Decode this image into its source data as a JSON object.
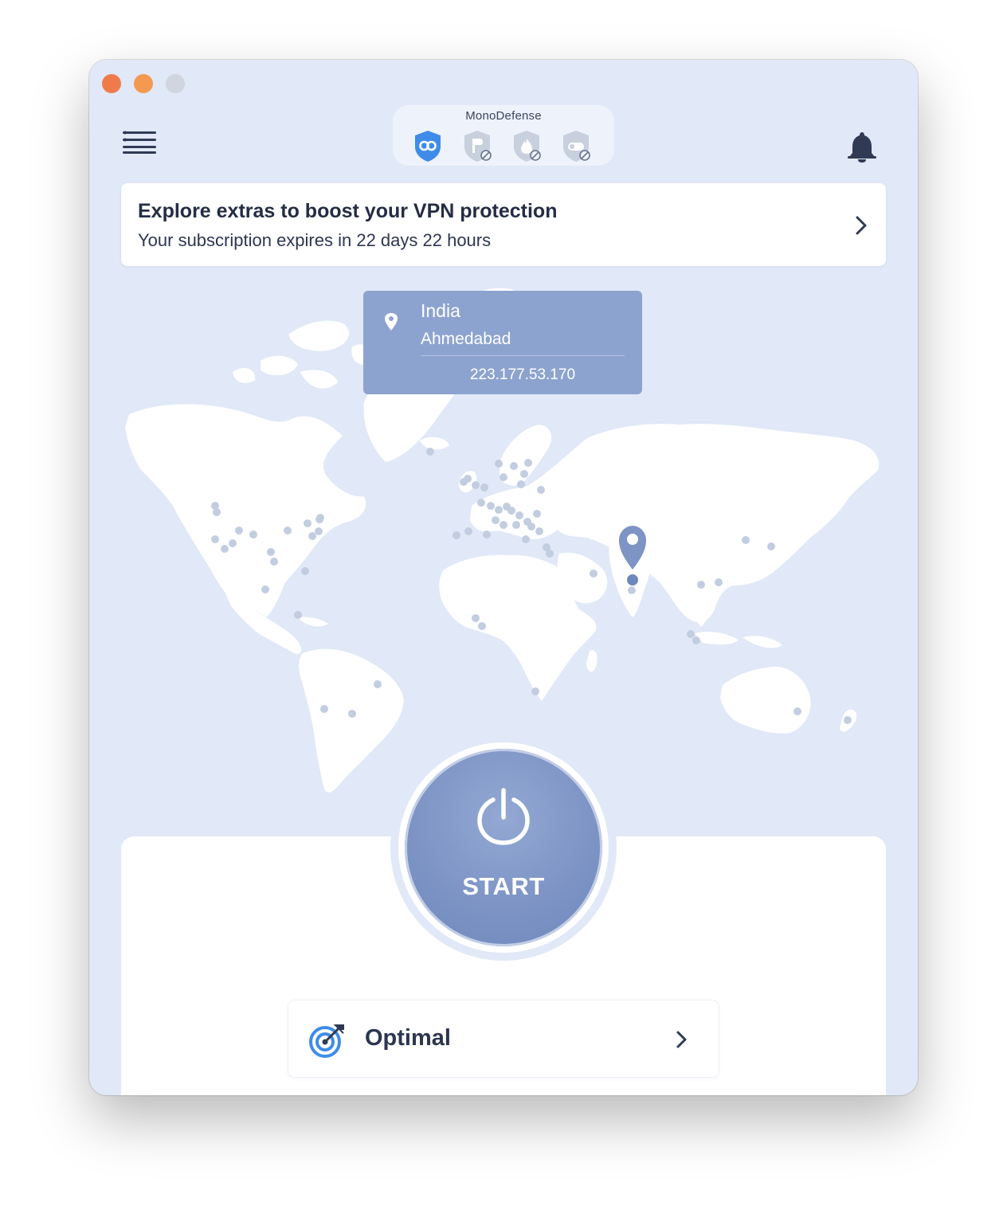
{
  "window": {
    "title": "MonoDefense"
  },
  "header": {
    "menu_icon": "hamburger-menu-icon",
    "bell_icon": "bell-icon",
    "monodefense": {
      "title": "MonoDefense",
      "products": [
        {
          "name": "vpn-shield-icon",
          "active": true,
          "color": "#3f8ce8"
        },
        {
          "name": "passwarden-shield-icon",
          "active": false
        },
        {
          "name": "dataspy-shield-icon",
          "active": false
        },
        {
          "name": "toggle-shield-icon",
          "active": false
        }
      ]
    }
  },
  "banner": {
    "title": "Explore extras to boost your VPN protection",
    "subtitle": "Your subscription expires in 22 days 22 hours"
  },
  "location": {
    "country": "India",
    "city": "Ahmedabad",
    "ip": "223.177.53.170"
  },
  "power": {
    "label": "START",
    "color": "#7d94c5"
  },
  "protocol": {
    "label": "Optimal",
    "icon": "target-icon"
  },
  "colors": {
    "window_bg": "#e1e8f7",
    "accent": "#3f8ce8",
    "card_bg": "#8da3cf",
    "text_dark": "#242d45"
  }
}
